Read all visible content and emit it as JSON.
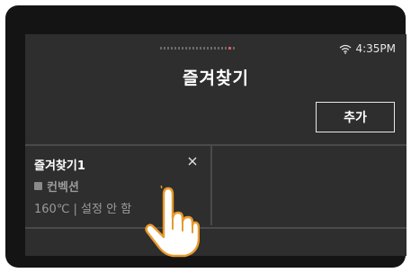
{
  "status": {
    "time": "4:35PM",
    "wifi_icon": "wifi-icon"
  },
  "pager": {
    "total": 21,
    "active_index": 19
  },
  "header": {
    "title": "즐겨찾기"
  },
  "toolbar": {
    "add_label": "추가"
  },
  "favorites": [
    {
      "name": "즐겨찾기1",
      "mode": "컨벡션",
      "setting": "160℃ | 설정 안 함",
      "close_icon": "close-icon"
    }
  ],
  "colors": {
    "accent": "#e25c5c",
    "screen_bg": "#2e2e2e",
    "bezel": "#141414"
  },
  "overlay": {
    "icon": "pointing-hand-icon"
  }
}
